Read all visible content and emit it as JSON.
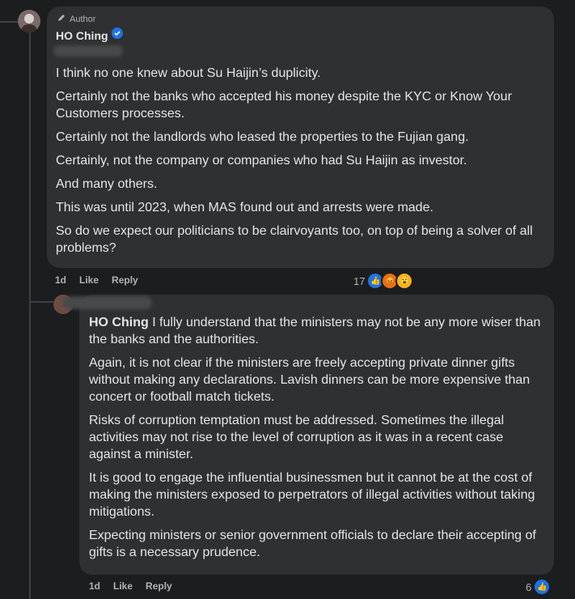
{
  "comment1": {
    "author_tag": "Author",
    "name": "HO Ching",
    "paragraphs": [
      "I think no one knew about Su Haijin’s duplicity.",
      "Certainly not the banks who accepted his money despite the KYC or Know Your Customers processes.",
      "Certainly not the landlords who leased the properties to the Fujian gang.",
      "Certainly, not the company or companies who had Su Haijin as investor.",
      "And many others.",
      "This was until 2023, when MAS found out and arrests were made.",
      "So do we expect our politicians to be clairvoyants too, on top of being a solver of all problems?"
    ],
    "time": "1d",
    "like_label": "Like",
    "reply_label": "Reply",
    "reaction_count": "17"
  },
  "comment2": {
    "mention": "HO Ching",
    "first_text": " I fully understand that the ministers may not be any more wiser than the banks and the authorities.",
    "paragraphs": [
      "Again, it is not clear if the ministers are freely accepting private dinner gifts without making any declarations. Lavish dinners can be more expensive than concert or football match tickets.",
      "Risks of corruption temptation must be addressed. Sometimes the illegal activities may not rise to the level of corruption as it was in a recent case against a minister.",
      "It is good to engage the influential businessmen but it cannot be at the cost of making the ministers exposed to perpetrators of illegal activities without taking mitigations.",
      "Expecting ministers or senior government officials to declare their accepting of gifts is a necessary prudence."
    ],
    "time": "1d",
    "like_label": "Like",
    "reply_label": "Reply",
    "reaction_count": "6"
  },
  "colors": {
    "background": "#1c1d1f",
    "bubble": "#2f3032",
    "text": "#e4e6eb",
    "muted": "#b0b3b8",
    "verified": "#1b74e4"
  },
  "icons": [
    "pencil-icon",
    "verified-badge-icon",
    "like-reaction-icon",
    "angry-reaction-icon",
    "wow-reaction-icon"
  ]
}
